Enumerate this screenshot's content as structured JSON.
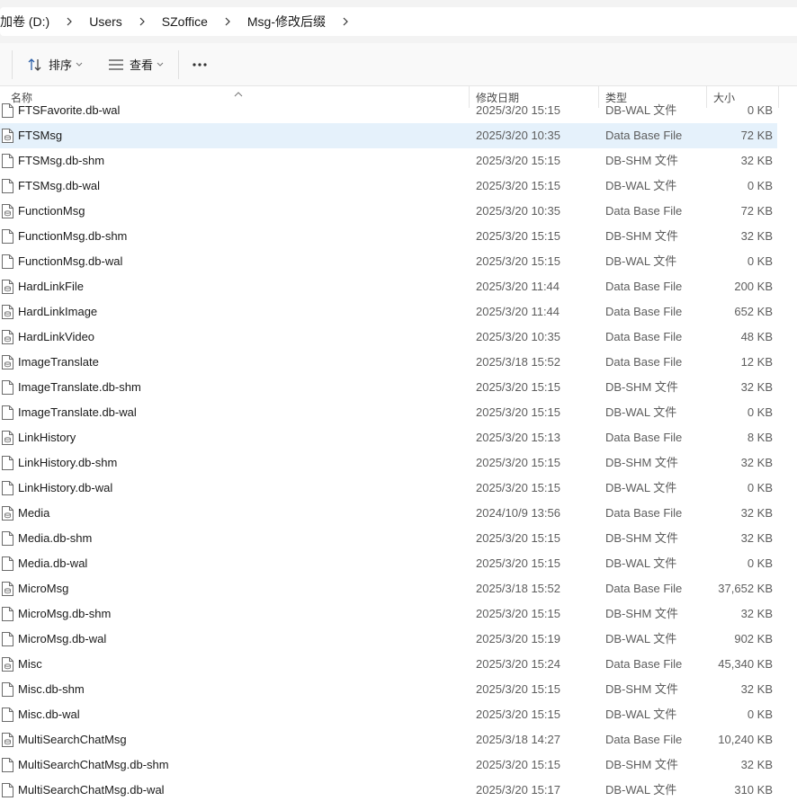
{
  "breadcrumb": [
    "加卷 (D:)",
    "Users",
    "SZoffice",
    "Msg-修改后缀"
  ],
  "toolbar": {
    "sort_label": "排序",
    "view_label": "查看",
    "more_label": "···"
  },
  "columns": {
    "name": "名称",
    "modified": "修改日期",
    "type": "类型",
    "size": "大小"
  },
  "files": [
    {
      "name": "FTSFavorite.db-wal",
      "modified": "2025/3/20 15:15",
      "type": "DB-WAL 文件",
      "size": "0 KB",
      "icon": "file-icon"
    },
    {
      "name": "FTSMsg",
      "modified": "2025/3/20 10:35",
      "type": "Data Base File",
      "size": "72 KB",
      "icon": "database-file-icon",
      "selected": true
    },
    {
      "name": "FTSMsg.db-shm",
      "modified": "2025/3/20 15:15",
      "type": "DB-SHM 文件",
      "size": "32 KB",
      "icon": "file-icon"
    },
    {
      "name": "FTSMsg.db-wal",
      "modified": "2025/3/20 15:15",
      "type": "DB-WAL 文件",
      "size": "0 KB",
      "icon": "file-icon"
    },
    {
      "name": "FunctionMsg",
      "modified": "2025/3/20 10:35",
      "type": "Data Base File",
      "size": "72 KB",
      "icon": "database-file-icon"
    },
    {
      "name": "FunctionMsg.db-shm",
      "modified": "2025/3/20 15:15",
      "type": "DB-SHM 文件",
      "size": "32 KB",
      "icon": "file-icon"
    },
    {
      "name": "FunctionMsg.db-wal",
      "modified": "2025/3/20 15:15",
      "type": "DB-WAL 文件",
      "size": "0 KB",
      "icon": "file-icon"
    },
    {
      "name": "HardLinkFile",
      "modified": "2025/3/20 11:44",
      "type": "Data Base File",
      "size": "200 KB",
      "icon": "database-file-icon"
    },
    {
      "name": "HardLinkImage",
      "modified": "2025/3/20 11:44",
      "type": "Data Base File",
      "size": "652 KB",
      "icon": "database-file-icon"
    },
    {
      "name": "HardLinkVideo",
      "modified": "2025/3/20 10:35",
      "type": "Data Base File",
      "size": "48 KB",
      "icon": "database-file-icon"
    },
    {
      "name": "ImageTranslate",
      "modified": "2025/3/18 15:52",
      "type": "Data Base File",
      "size": "12 KB",
      "icon": "database-file-icon"
    },
    {
      "name": "ImageTranslate.db-shm",
      "modified": "2025/3/20 15:15",
      "type": "DB-SHM 文件",
      "size": "32 KB",
      "icon": "file-icon"
    },
    {
      "name": "ImageTranslate.db-wal",
      "modified": "2025/3/20 15:15",
      "type": "DB-WAL 文件",
      "size": "0 KB",
      "icon": "file-icon"
    },
    {
      "name": "LinkHistory",
      "modified": "2025/3/20 15:13",
      "type": "Data Base File",
      "size": "8 KB",
      "icon": "database-file-icon"
    },
    {
      "name": "LinkHistory.db-shm",
      "modified": "2025/3/20 15:15",
      "type": "DB-SHM 文件",
      "size": "32 KB",
      "icon": "file-icon"
    },
    {
      "name": "LinkHistory.db-wal",
      "modified": "2025/3/20 15:15",
      "type": "DB-WAL 文件",
      "size": "0 KB",
      "icon": "file-icon"
    },
    {
      "name": "Media",
      "modified": "2024/10/9 13:56",
      "type": "Data Base File",
      "size": "32 KB",
      "icon": "database-file-icon"
    },
    {
      "name": "Media.db-shm",
      "modified": "2025/3/20 15:15",
      "type": "DB-SHM 文件",
      "size": "32 KB",
      "icon": "file-icon"
    },
    {
      "name": "Media.db-wal",
      "modified": "2025/3/20 15:15",
      "type": "DB-WAL 文件",
      "size": "0 KB",
      "icon": "file-icon"
    },
    {
      "name": "MicroMsg",
      "modified": "2025/3/18 15:52",
      "type": "Data Base File",
      "size": "37,652 KB",
      "icon": "database-file-icon"
    },
    {
      "name": "MicroMsg.db-shm",
      "modified": "2025/3/20 15:15",
      "type": "DB-SHM 文件",
      "size": "32 KB",
      "icon": "file-icon"
    },
    {
      "name": "MicroMsg.db-wal",
      "modified": "2025/3/20 15:19",
      "type": "DB-WAL 文件",
      "size": "902 KB",
      "icon": "file-icon"
    },
    {
      "name": "Misc",
      "modified": "2025/3/20 15:24",
      "type": "Data Base File",
      "size": "45,340 KB",
      "icon": "database-file-icon"
    },
    {
      "name": "Misc.db-shm",
      "modified": "2025/3/20 15:15",
      "type": "DB-SHM 文件",
      "size": "32 KB",
      "icon": "file-icon"
    },
    {
      "name": "Misc.db-wal",
      "modified": "2025/3/20 15:15",
      "type": "DB-WAL 文件",
      "size": "0 KB",
      "icon": "file-icon"
    },
    {
      "name": "MultiSearchChatMsg",
      "modified": "2025/3/18 14:27",
      "type": "Data Base File",
      "size": "10,240 KB",
      "icon": "database-file-icon"
    },
    {
      "name": "MultiSearchChatMsg.db-shm",
      "modified": "2025/3/20 15:15",
      "type": "DB-SHM 文件",
      "size": "32 KB",
      "icon": "file-icon"
    },
    {
      "name": "MultiSearchChatMsg.db-wal",
      "modified": "2025/3/20 15:17",
      "type": "DB-WAL 文件",
      "size": "310 KB",
      "icon": "file-icon"
    }
  ],
  "colors": {
    "selected_row": "#e5f1fb",
    "toolbar_bg": "#f9f9f9",
    "address_bg": "#f3f3f3"
  }
}
